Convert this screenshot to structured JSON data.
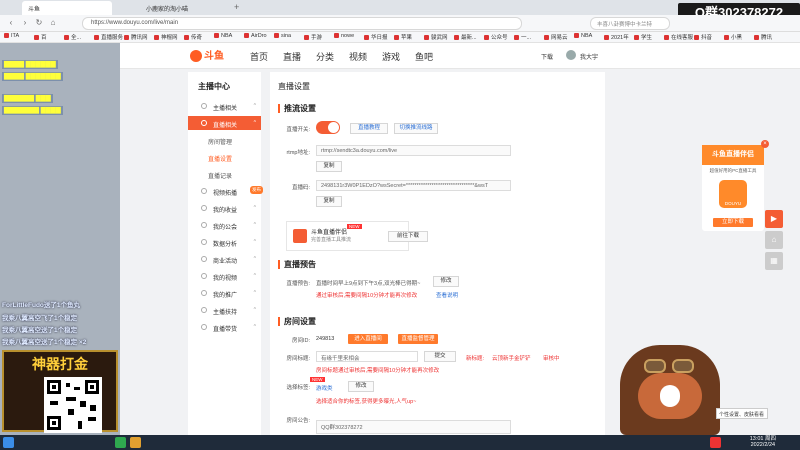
{
  "overlay": {
    "qq_group": "Q群302378272",
    "danmu": [
      "ForLittleFudo送了1个鱼丸",
      "我乘八翼高空飞了1个稳定",
      "我乘八翼高空送了1个稳定",
      "我乘八翼高空送了1个稳定 ×2"
    ],
    "promo_title": "神器打金"
  },
  "browser": {
    "tabs": [
      "斗鱼",
      "小鹿家的淘小喵"
    ],
    "url": "https://www.douyu.com/live/main",
    "search_placeholder": "丰喜八卦赛博中卡兰特",
    "bookmarks": [
      "ITA",
      "百",
      "全...",
      "直播服务",
      "腾讯网",
      "神棍网",
      "传奇",
      "NBA",
      "AirDro",
      "sina",
      "手游",
      "nowe",
      "华日报",
      "苹果",
      "骏武网",
      "最新...",
      "公众号",
      "一...",
      "网易云",
      "NBA",
      "2021年",
      "学生",
      "在线客服",
      "抖音",
      "小黑",
      "腾讯"
    ]
  },
  "site": {
    "logo": "斗鱼",
    "nav": [
      "首页",
      "直播",
      "分类",
      "视频",
      "游戏",
      "鱼吧"
    ],
    "download": "下载",
    "user": "我大宇"
  },
  "sidebar": {
    "title": "主播中心",
    "items": [
      {
        "label": "主播相关",
        "type": "group"
      },
      {
        "label": "直播相关",
        "type": "active"
      },
      {
        "label": "房间管理",
        "type": "sub"
      },
      {
        "label": "直播设置",
        "type": "subsel"
      },
      {
        "label": "直播记录",
        "type": "sub"
      },
      {
        "label": "视频拓播",
        "type": "group",
        "badge": "发布"
      },
      {
        "label": "我的收益",
        "type": "group"
      },
      {
        "label": "我的公会",
        "type": "group"
      },
      {
        "label": "数据分析",
        "type": "group"
      },
      {
        "label": "商业活动",
        "type": "group"
      },
      {
        "label": "我的视频",
        "type": "group"
      },
      {
        "label": "我的推广",
        "type": "group"
      },
      {
        "label": "主播扶持",
        "type": "group"
      },
      {
        "label": "直播带货",
        "type": "group"
      }
    ]
  },
  "main": {
    "crumb": "直播设置",
    "push": {
      "title": "推流设置",
      "switch_label": "直播开关:",
      "tutorial": "直播教程",
      "switch_line": "切换推流线路",
      "rtmp_label": "rtmp地址:",
      "rtmp_value": "rtmp://sendtc3a.douyu.com/live",
      "copy": "复制",
      "code_label": "直播码:",
      "code_value": "2498131r3W0P1EDzO?wsSecret=********************************&wsT",
      "copy2": "复制",
      "companion_name": "斗鱼直播伴侣",
      "companion_desc": "完善直播工具推流",
      "new_badge": "NEW",
      "download_btn": "前往下载"
    },
    "notice": {
      "title": "直播预告",
      "label": "直播预告:",
      "value": "直播时间早上9点到下午3点,双光棒已得期~",
      "edit": "修改",
      "warn": "通过审核后,需要间隔10分钟才能再次修改",
      "link": "查看说明"
    },
    "room": {
      "title": "房间设置",
      "id_label": "房间ID:",
      "id_value": "249813",
      "enter_btn": "进入直播间",
      "preview_btn": "直播监督管理",
      "name_label": "房间标题:",
      "name_value": "有缘千里来相会",
      "submit": "提交",
      "new_title_label": "新标题:",
      "new_title_value": "云顶新手金铲铲",
      "review": "审核中",
      "name_warn": "房间标题通过审核后,需要间隔10分钟才能再次修改",
      "cat_label": "选择标签:",
      "cat_value": "游戏类",
      "cat_edit": "修改",
      "cat_warn": "选择适合你的标签,获得更多曝光,人气up~",
      "notice_label": "房间公告:",
      "notice_value": "QQ群302378272"
    }
  },
  "ad": {
    "title": "斗鱼直播伴侣",
    "desc": "超值好用的PC直播工具",
    "app": "DOUYU",
    "btn": "立即下载"
  },
  "taskbar": {
    "time": "13:01 周四",
    "date": "2022/2/24",
    "tooltip": "个性设置、皮肤看看"
  }
}
